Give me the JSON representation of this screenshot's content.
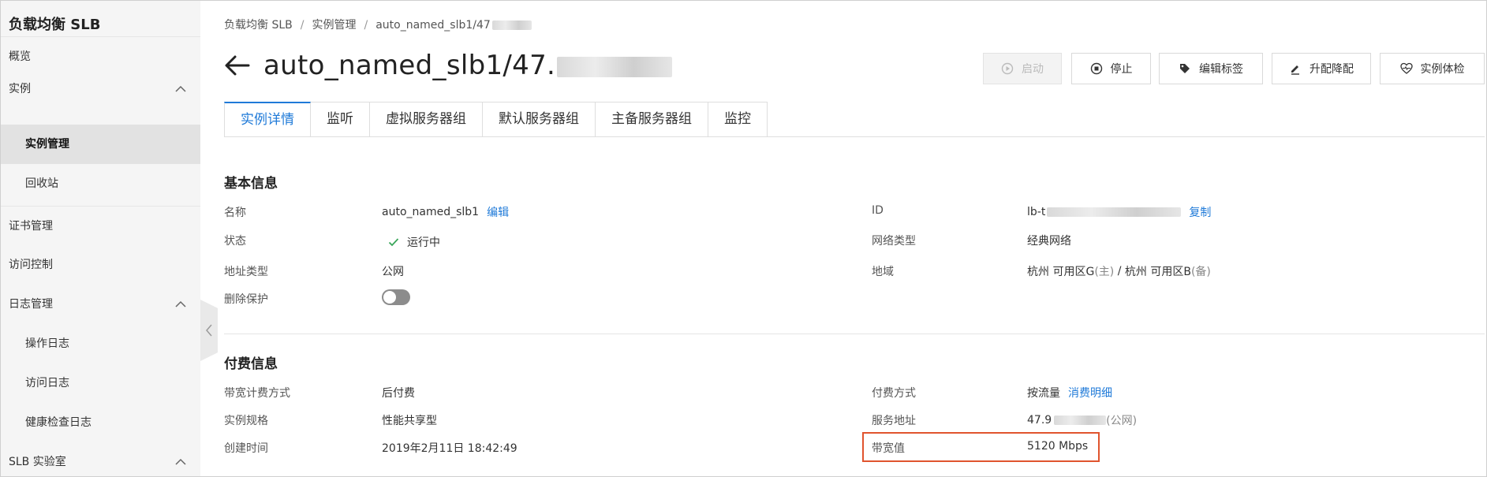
{
  "sidebar": {
    "title": "负载均衡 SLB",
    "items": [
      {
        "label": "概览"
      },
      {
        "label": "实例"
      },
      {
        "label": "实例管理"
      },
      {
        "label": "回收站"
      },
      {
        "label": "证书管理"
      },
      {
        "label": "访问控制"
      },
      {
        "label": "日志管理"
      },
      {
        "label": "操作日志"
      },
      {
        "label": "访问日志"
      },
      {
        "label": "健康检查日志"
      },
      {
        "label": "SLB 实验室"
      }
    ]
  },
  "breadcrumb": {
    "items": [
      "负载均衡 SLB",
      "实例管理",
      "auto_named_slb1/47"
    ],
    "separator": "/"
  },
  "header": {
    "title_prefix": "auto_named_slb1/47.",
    "buttons": {
      "start": "启动",
      "stop": "停止",
      "edit_tags": "编辑标签",
      "upgrade": "升配降配",
      "inspect": "实例体检"
    }
  },
  "tabs": [
    {
      "label": "实例详情",
      "active": true
    },
    {
      "label": "监听"
    },
    {
      "label": "虚拟服务器组"
    },
    {
      "label": "默认服务器组"
    },
    {
      "label": "主备服务器组"
    },
    {
      "label": "监控"
    }
  ],
  "basic": {
    "title": "基本信息",
    "name_label": "名称",
    "name_value": "auto_named_slb1",
    "edit_link": "编辑",
    "status_label": "状态",
    "status_value": "运行中",
    "addr_type_label": "地址类型",
    "addr_type_value": "公网",
    "delete_protect_label": "删除保护",
    "delete_protect_on": false,
    "id_label": "ID",
    "id_value_prefix": "lb-t",
    "copy_link": "复制",
    "net_type_label": "网络类型",
    "net_type_value": "经典网络",
    "region_label": "地域",
    "region_primary": "杭州 可用区G",
    "region_primary_tag": "(主)",
    "region_sep": " / ",
    "region_backup": "杭州 可用区B",
    "region_backup_tag": "(备)"
  },
  "billing": {
    "title": "付费信息",
    "bw_billing_label": "带宽计费方式",
    "bw_billing_value": "后付费",
    "spec_label": "实例规格",
    "spec_value": "性能共享型",
    "created_label": "创建时间",
    "created_value": "2019年2月11日 18:42:49",
    "pay_method_label": "付费方式",
    "pay_method_value": "按流量",
    "detail_link": "消费明细",
    "service_addr_label": "服务地址",
    "service_addr_prefix": "47.9",
    "service_addr_tag": "(公网)",
    "bandwidth_label": "带宽值",
    "bandwidth_value": "5120 Mbps"
  },
  "colors": {
    "accent": "#1f7ad8",
    "highlight": "#e0542e",
    "status_ok": "#3aa65a"
  },
  "icons": {
    "back": "arrow-left-icon",
    "start": "play-circle-icon",
    "stop": "stop-circle-icon",
    "tag": "tag-icon",
    "upgrade": "edit-pen-icon",
    "inspect": "heart-pulse-icon",
    "status": "check-icon",
    "collapse": "chevron-up-icon",
    "sidebar_toggle": "chevron-left-icon"
  }
}
